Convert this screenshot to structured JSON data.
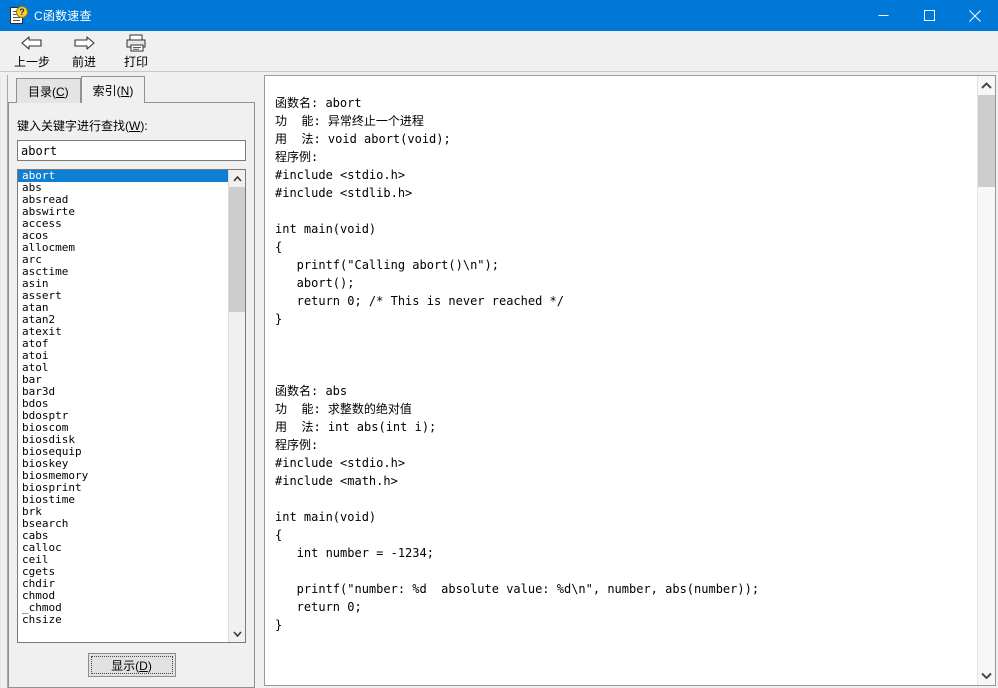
{
  "window": {
    "title": "C函数速查",
    "icon": "help-document-icon",
    "question_mark": "?",
    "accent_color": "#0078d7",
    "controls": {
      "minimize": "minimize-icon",
      "maximize": "maximize-icon",
      "close": "close-icon"
    }
  },
  "toolbar": {
    "buttons": [
      {
        "label": "上一步",
        "icon": "back-arrow-icon"
      },
      {
        "label": "前进",
        "icon": "forward-arrow-icon"
      },
      {
        "label": "打印",
        "icon": "printer-icon"
      }
    ]
  },
  "left_pane": {
    "tabs": [
      {
        "label": "目录(C)",
        "text": "目录",
        "accel": "C",
        "active": false
      },
      {
        "label": "索引(N)",
        "text": "索引",
        "accel": "N",
        "active": true
      }
    ],
    "search_label_text": "键入关键字进行查找(",
    "search_label_accel": "W",
    "search_label_tail": "):",
    "search_input": {
      "value": "abort",
      "placeholder": ""
    },
    "list": {
      "selected_index": 0,
      "items": [
        "abort",
        "abs",
        "absread",
        "abswirte",
        "access",
        "acos",
        "allocmem",
        "arc",
        "asctime",
        "asin",
        "assert",
        "atan",
        "atan2",
        "atexit",
        "atof",
        "atoi",
        "atol",
        "bar",
        "bar3d",
        "bdos",
        "bdosptr",
        "bioscom",
        "biosdisk",
        "biosequip",
        "bioskey",
        "biosmemory",
        "biosprint",
        "biostime",
        "brk",
        "bsearch",
        "cabs",
        "calloc",
        "ceil",
        "cgets",
        "chdir",
        "chmod",
        "_chmod",
        "chsize"
      ]
    },
    "show_button": {
      "text": "显示",
      "accel": "D",
      "label": "显示(D)"
    }
  },
  "document": {
    "lines": [
      "函数名: abort",
      "功  能: 异常终止一个进程",
      "用  法: void abort(void);",
      "程序例:",
      "#include <stdio.h>",
      "#include <stdlib.h>",
      "",
      "int main(void)",
      "{",
      "   printf(\"Calling abort()\\n\");",
      "   abort();",
      "   return 0; /* This is never reached */",
      "}",
      "",
      "",
      "",
      "函数名: abs",
      "功  能: 求整数的绝对值",
      "用  法: int abs(int i);",
      "程序例:",
      "#include <stdio.h>",
      "#include <math.h>",
      "",
      "int main(void)",
      "{",
      "   int number = -1234;",
      "",
      "   printf(\"number: %d  absolute value: %d\\n\", number, abs(number));",
      "   return 0;",
      "}"
    ]
  }
}
